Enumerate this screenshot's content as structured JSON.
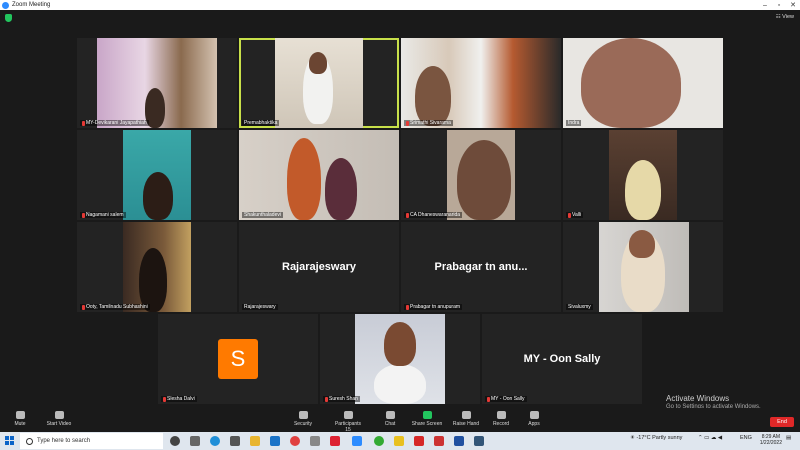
{
  "window": {
    "title": "Zoom Meeting"
  },
  "header": {
    "view_label": "View"
  },
  "participants": [
    {
      "name": "MY-Devikarani Jayapathiah"
    },
    {
      "name": "Premabhaktika"
    },
    {
      "name": "Srimathi Sivarama"
    },
    {
      "name": "Indra"
    },
    {
      "name": "Nagamani salem"
    },
    {
      "name": "Shakunthaladevi"
    },
    {
      "name": "CA Dhaneswaranarida"
    },
    {
      "name": "Valli"
    },
    {
      "name": "Ooty, Tamilnadu Subhashini"
    },
    {
      "name": "Rajarajeswary",
      "display": "Rajarajeswary"
    },
    {
      "name": "Prabagar tn anupuram",
      "display": "Prabagar tn anu..."
    },
    {
      "name": "Sivaluxmy"
    },
    {
      "name": "Slesha Dalvi",
      "avatar_letter": "S"
    },
    {
      "name": "Suresh Shan"
    },
    {
      "name": "MY - Oon Sally",
      "display": "MY - Oon Sally"
    }
  ],
  "toolbar": {
    "mute": "Mute",
    "start_video": "Start Video",
    "security": "Security",
    "participants": "Participants",
    "participants_count": "15",
    "chat": "Chat",
    "share_screen": "Share Screen",
    "raise_hand": "Raise Hand",
    "record": "Record",
    "apps": "Apps",
    "end": "End"
  },
  "watermark": {
    "title": "Activate Windows",
    "subtitle": "Go to Settings to activate Windows."
  },
  "taskbar": {
    "search_placeholder": "Type here to search",
    "weather": "-17°C  Partly sunny",
    "lang": "ENG",
    "time": "8:29 AM",
    "date": "1/22/2022"
  },
  "colors": {
    "active_outline": "#c8e04a",
    "zoom_blue": "#2d8cff",
    "end_red": "#e02828",
    "avatar_orange": "#ff7a00"
  }
}
